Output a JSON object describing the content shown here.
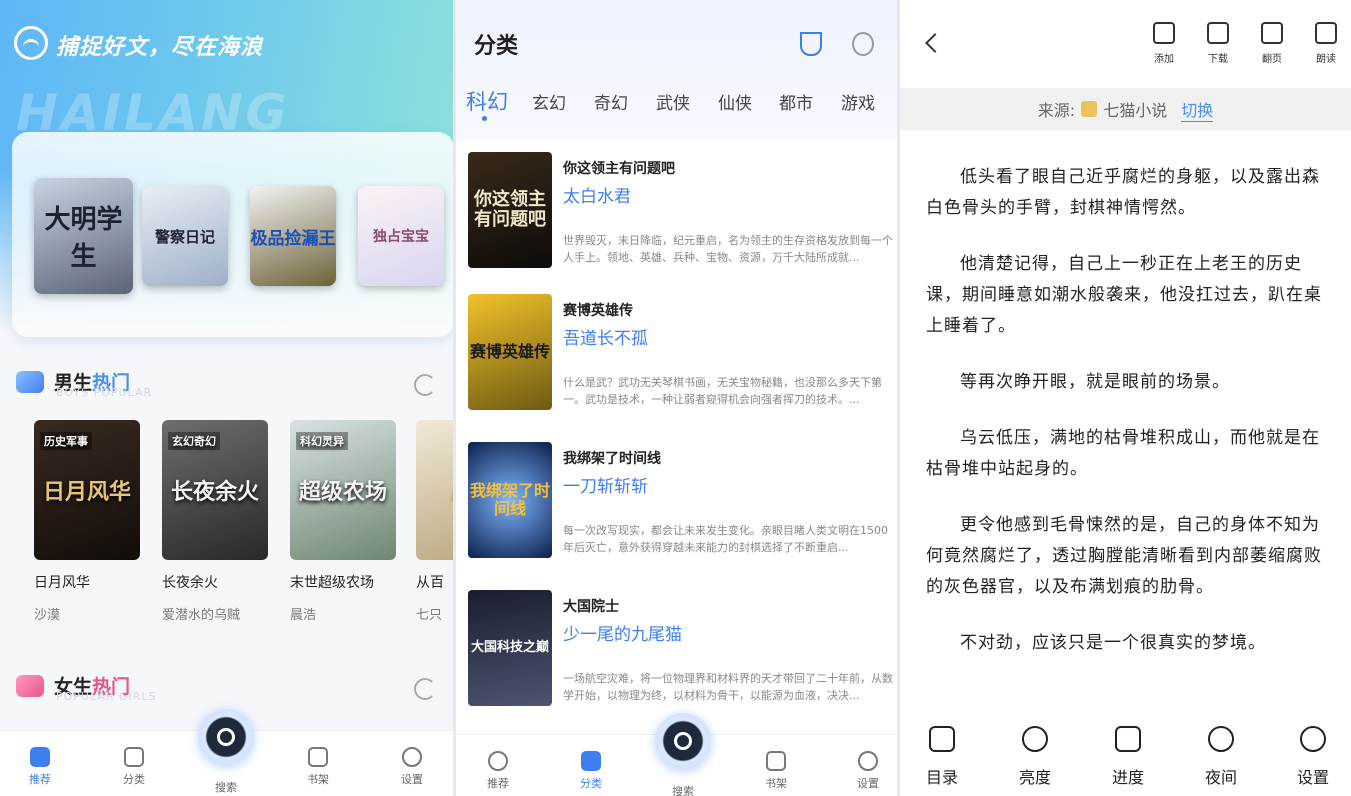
{
  "panel_home": {
    "slogan": "捕捉好文，尽在海浪",
    "watermark": "HAILANG",
    "banner_books": [
      {
        "title": "大明学生"
      },
      {
        "title": "警察日记"
      },
      {
        "title": "极品捡漏王"
      },
      {
        "title": "独占宝宝"
      }
    ],
    "boys": {
      "title_plain": "男生",
      "title_accent": "热门",
      "subtitle": "BOYS POPULAR",
      "books": [
        {
          "tag": "历史军事",
          "cover": "日月风华",
          "title": "日月风华",
          "author": "沙漠"
        },
        {
          "tag": "玄幻奇幻",
          "cover": "长夜余火",
          "title": "长夜余火",
          "author": "爱潜水的乌贼"
        },
        {
          "tag": "科幻灵异",
          "cover": "超级农场",
          "title": "末世超级农场",
          "author": "晨浩"
        },
        {
          "tag": "",
          "cover": "从百",
          "title": "从百",
          "author": "七只"
        }
      ]
    },
    "girls": {
      "title_plain": "女生",
      "title_accent": "热门",
      "subtitle": "POPULAR GIRLS"
    },
    "tabbar": {
      "recommend": "推荐",
      "category": "分类",
      "search": "搜索",
      "shelf": "书架",
      "settings": "设置"
    }
  },
  "panel_category": {
    "title": "分类",
    "categories": [
      "科幻",
      "玄幻",
      "奇幻",
      "武侠",
      "仙侠",
      "都市",
      "游戏"
    ],
    "books": [
      {
        "cover": "你这领主有问题吧",
        "title": "你这领主有问题吧",
        "author": "太白水君",
        "desc": "世界毁灭，末日降临，纪元重启，名为领主的生存资格发放到每一个人手上。领地、英雄、兵种、宝物、资源，万千大陆所成就..."
      },
      {
        "cover": "赛博英雄传",
        "title": "赛博英雄传",
        "author": "吾道长不孤",
        "desc": "什么是武？武功无关琴棋书画，无关宝物秘籍，也没那么多天下第一。武功是技术，一种让弱者窥得机会向强者挥刀的技术。..."
      },
      {
        "cover": "我绑架了时间线",
        "title": "我绑架了时间线",
        "author": "一刀斩斩斩",
        "desc": "每一次改写现实，都会让未来发生变化。亲眼目睹人类文明在1500年后灭亡，意外获得穿越未来能力的封棋选择了不断重启..."
      },
      {
        "cover": "大国科技之巅",
        "title": "大国院士",
        "author": "少一尾的九尾猫",
        "desc": "一场航空灾难，将一位物理界和材料界的天才带回了二十年前，从数学开始，以物理为终，以材料为骨干，以能源为血液，决决..."
      }
    ],
    "tabbar": {
      "recommend": "推荐",
      "category": "分类",
      "search": "搜索",
      "shelf": "书架",
      "settings": "设置"
    }
  },
  "panel_reader": {
    "toolbar": {
      "add": "添加",
      "download": "下载",
      "page": "翻页",
      "read_aloud": "朗读"
    },
    "source_label": "来源:",
    "source_name": "七猫小说",
    "switch": "切换",
    "paragraphs": [
      "低头看了眼自己近乎腐烂的身躯，以及露出森白色骨头的手臂，封棋神情愕然。",
      "他清楚记得，自己上一秒正在上老王的历史课，期间睡意如潮水般袭来，他没扛过去，趴在桌上睡着了。",
      "等再次睁开眼，就是眼前的场景。",
      "乌云低压，满地的枯骨堆积成山，而他就是在枯骨堆中站起身的。",
      "更令他感到毛骨悚然的是，自己的身体不知为何竟然腐烂了，透过胸膛能清晰看到内部萎缩腐败的灰色器官，以及布满划痕的肋骨。",
      "不对劲，应该只是一个很真实的梦境。"
    ],
    "bottom": {
      "toc": "目录",
      "brightness": "亮度",
      "progress": "进度",
      "night": "夜间",
      "settings": "设置"
    }
  }
}
